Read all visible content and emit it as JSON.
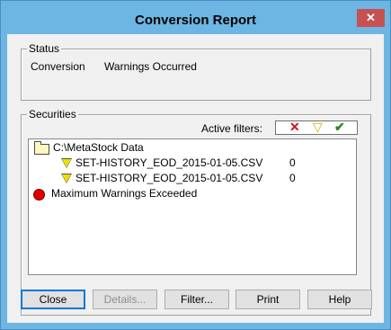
{
  "window": {
    "title": "Conversion Report",
    "close_glyph": "✕"
  },
  "status": {
    "group_label": "Status",
    "field_label": "Conversion",
    "field_value": "Warnings Occurred"
  },
  "securities": {
    "group_label": "Securities",
    "filters_label": "Active filters:",
    "filter_icons": [
      "red-x-icon",
      "yellow-warning-triangle-icon",
      "green-check-icon"
    ],
    "rows": [
      {
        "icon": "folder-icon",
        "text": "C:\\MetaStock Data",
        "count": ""
      },
      {
        "icon": "warning-triangle-icon",
        "text": "SET-HISTORY_EOD_2015-01-05.CSV",
        "count": "0"
      },
      {
        "icon": "warning-triangle-icon",
        "text": "SET-HISTORY_EOD_2015-01-05.CSV",
        "count": "0"
      },
      {
        "icon": "red-error-dot-icon",
        "text": "Maximum Warnings Exceeded",
        "count": ""
      }
    ]
  },
  "buttons": {
    "close": "Close",
    "details": "Details...",
    "filter": "Filter...",
    "print": "Print",
    "help": "Help"
  },
  "colors": {
    "error": "#e00000",
    "warning": "#ede000",
    "ok": "#1f8a1f",
    "title_close_bg": "#c75050"
  }
}
